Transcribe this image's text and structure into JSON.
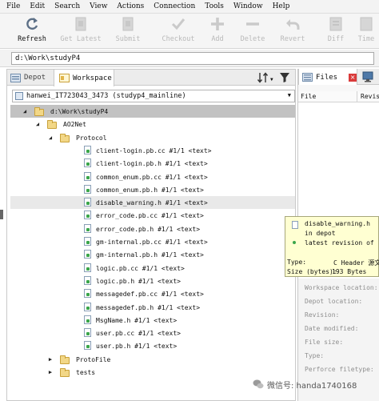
{
  "menu": [
    "File",
    "Edit",
    "Search",
    "View",
    "Actions",
    "Connection",
    "Tools",
    "Window",
    "Help"
  ],
  "toolbar": [
    {
      "label": "Refresh",
      "icon": "refresh-icon",
      "enabled": true
    },
    {
      "label": "Get Latest",
      "icon": "get-latest-icon",
      "enabled": false
    },
    {
      "label": "Submit",
      "icon": "submit-icon",
      "enabled": false
    },
    {
      "label": "Checkout",
      "icon": "checkout-icon",
      "enabled": false
    },
    {
      "label": "Add",
      "icon": "add-icon",
      "enabled": false
    },
    {
      "label": "Delete",
      "icon": "delete-icon",
      "enabled": false
    },
    {
      "label": "Revert",
      "icon": "revert-icon",
      "enabled": false
    },
    {
      "label": "Diff",
      "icon": "diff-icon",
      "enabled": false
    },
    {
      "label": "Time",
      "icon": "timelapse-icon",
      "enabled": false
    }
  ],
  "path": "d:\\Work\\studyP4",
  "left_tabs": [
    {
      "label": "Depot",
      "icon": "depot-icon",
      "active": false
    },
    {
      "label": "Workspace",
      "icon": "workspace-icon",
      "active": true
    }
  ],
  "workspace_selector": "hanwei_IT723043_3473  (studyp4_mainline)",
  "tree": [
    {
      "label": "d:\\Work\\studyP4",
      "type": "folder",
      "expanded": true,
      "root": true
    },
    {
      "label": "AO2Net",
      "type": "folder",
      "expanded": true
    },
    {
      "label": "Protocol",
      "type": "folder",
      "expanded": true
    },
    {
      "label": "client-login.pb.cc #1/1 <text>",
      "type": "file"
    },
    {
      "label": "client-login.pb.h #1/1 <text>",
      "type": "file"
    },
    {
      "label": "common_enum.pb.cc #1/1 <text>",
      "type": "file"
    },
    {
      "label": "common_enum.pb.h #1/1 <text>",
      "type": "file"
    },
    {
      "label": "disable_warning.h #1/1 <text>",
      "type": "file",
      "hover": true
    },
    {
      "label": "error_code.pb.cc #1/1 <text>",
      "type": "file"
    },
    {
      "label": "error_code.pb.h #1/1 <text>",
      "type": "file"
    },
    {
      "label": "gm-internal.pb.cc #1/1 <text>",
      "type": "file"
    },
    {
      "label": "gm-internal.pb.h #1/1 <text>",
      "type": "file"
    },
    {
      "label": "logic.pb.cc #1/1 <text>",
      "type": "file"
    },
    {
      "label": "logic.pb.h #1/1 <text>",
      "type": "file"
    },
    {
      "label": "messagedef.pb.cc #1/1 <text>",
      "type": "file"
    },
    {
      "label": "messagedef.pb.h #1/1 <text>",
      "type": "file"
    },
    {
      "label": "MsgName.h #1/1 <text>",
      "type": "file"
    },
    {
      "label": "user.pb.cc #1/1 <text>",
      "type": "file"
    },
    {
      "label": "user.pb.h #1/1 <text>",
      "type": "file"
    },
    {
      "label": "ProtoFile",
      "type": "folder",
      "expanded": false
    },
    {
      "label": "tests",
      "type": "folder",
      "expanded": false
    }
  ],
  "right_tab": {
    "label": "Files"
  },
  "files_columns": [
    "File",
    "Revis"
  ],
  "properties": [
    "Workspace location:",
    "Depot location:",
    "Revision:",
    "Date modified:",
    "File size:",
    "Type:",
    "Perforce filetype:"
  ],
  "tooltip": {
    "title": "disable_warning.h",
    "line2": "in  depot",
    "line3": "latest  revision  of",
    "type_label": "Type:",
    "type_value": "C Header 源文",
    "size_label": "Size (bytes):",
    "size_value": "193 Bytes"
  },
  "watermark": "微信号: handa1740168",
  "colors": {
    "selection": "#c2c2c2",
    "tooltip_bg": "#ffffd2",
    "green_check": "#3aa64a",
    "close_red": "#d93a3a"
  }
}
